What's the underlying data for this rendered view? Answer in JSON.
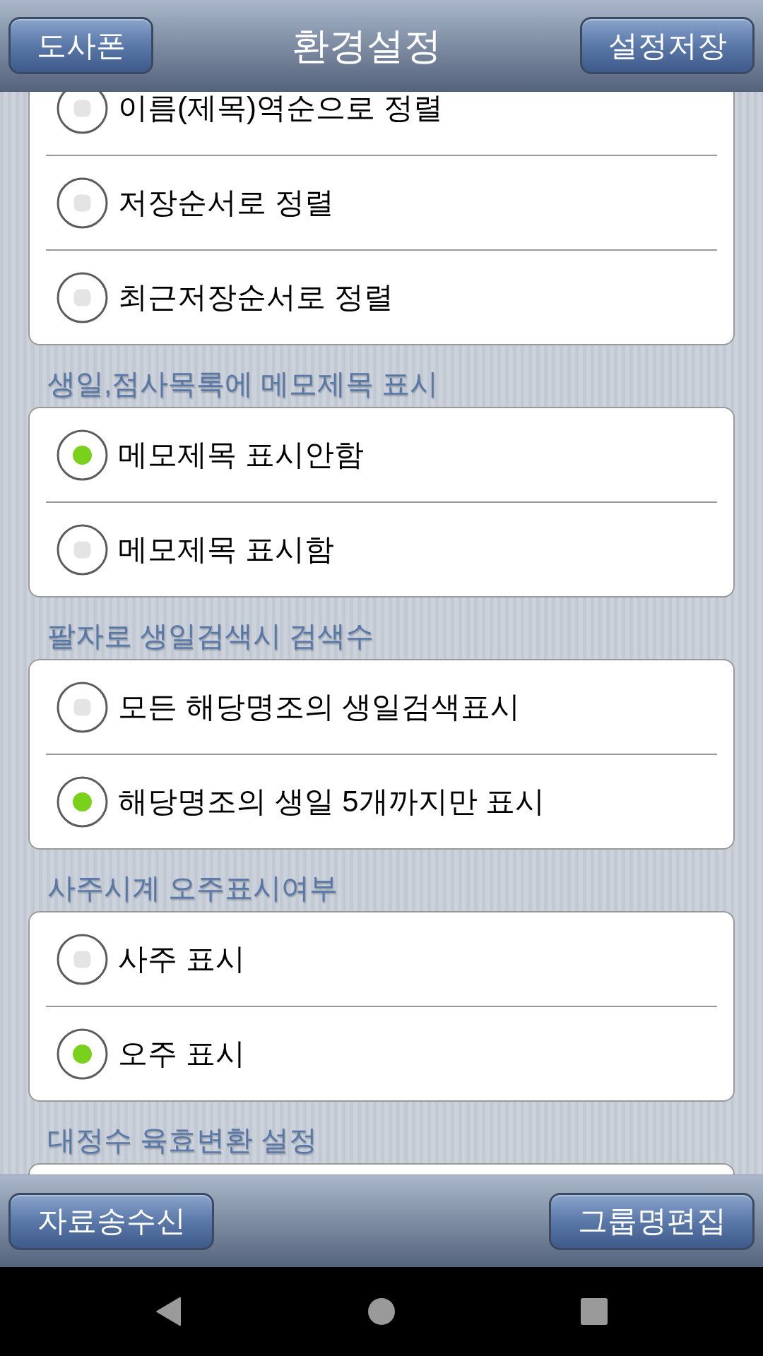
{
  "top_bar": {
    "left_button": "도사폰",
    "title": "환경설정",
    "right_button": "설정저장"
  },
  "sections": [
    {
      "options": [
        {
          "label": "이름(제목)역순으로 정렬",
          "selected": false
        },
        {
          "label": "저장순서로 정렬",
          "selected": false
        },
        {
          "label": "최근저장순서로 정렬",
          "selected": false
        }
      ]
    },
    {
      "title": "생일,점사목록에 메모제목 표시",
      "options": [
        {
          "label": "메모제목 표시안함",
          "selected": true
        },
        {
          "label": "메모제목 표시함",
          "selected": false
        }
      ]
    },
    {
      "title": "팔자로 생일검색시 검색수",
      "options": [
        {
          "label": "모든 해당명조의 생일검색표시",
          "selected": false
        },
        {
          "label": "해당명조의 생일 5개까지만 표시",
          "selected": true
        }
      ]
    },
    {
      "title": "사주시계 오주표시여부",
      "options": [
        {
          "label": "사주 표시",
          "selected": false
        },
        {
          "label": "오주 표시",
          "selected": true
        }
      ]
    },
    {
      "title": "대정수 육효변환 설정"
    }
  ],
  "bottom_bar": {
    "buttons": [
      "자료송수신",
      "그룹명편집"
    ]
  }
}
